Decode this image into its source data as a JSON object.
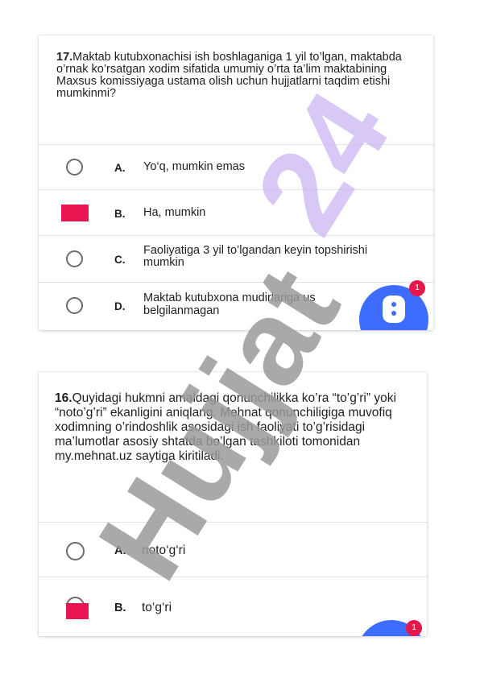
{
  "question17": {
    "number": "17.",
    "text": "Maktab kutubxonachisi ish boshlaganiga 1 yil to’lgan, maktabda o’rnak ko’rsatgan xodim sifatida umumiy o’rta ta’lim maktabining Maxsus komissiyaga ustama olish uchun hujjatlarni taqdim etishi mumkinmi?",
    "options": [
      {
        "letter": "A.",
        "text": "Yo‘q, mumkin emas",
        "selected": false
      },
      {
        "letter": "B.",
        "text": "Ha, mumkin",
        "selected": true
      },
      {
        "letter": "C.",
        "text": "Faoliyatiga 3 yil to’lgandan keyin topshirishi mumkin",
        "selected": false
      },
      {
        "letter": "D.",
        "text": "Maktab kutubxona mudirlariga us",
        "text2": "belgilanmagan",
        "selected": false
      }
    ],
    "chat_badge": "1"
  },
  "question16": {
    "number": "16.",
    "text": "Quyidagi hukmni amaldagi qonunchilikka ko’ra “to’g’ri” yoki “noto’g’ri” ekanligini aniqlang. Mehnat qonunchiligiga muvofiq xodimning o’rindoshlik asosidagi ish faoliyati to’g’risidagi ma’lumotlar asosiy shtatda bo’lgan tashkiloti tomonidan my.mehnat.uz saytiga kiritiladi.",
    "options": [
      {
        "letter": "A.",
        "text": "noto‘g‘ri",
        "selected": false
      },
      {
        "letter": "B.",
        "text": "to‘g‘ri",
        "selected": true
      }
    ],
    "chat_badge": "1"
  },
  "watermark": {
    "text": "Hujjat 24",
    "color_hujjat": "#9a9a9a",
    "color_24": "#c9b6f2"
  },
  "colors": {
    "selected_mark": "#ea1450",
    "chat_button": "#3d6cff",
    "badge": "#e8174b"
  }
}
